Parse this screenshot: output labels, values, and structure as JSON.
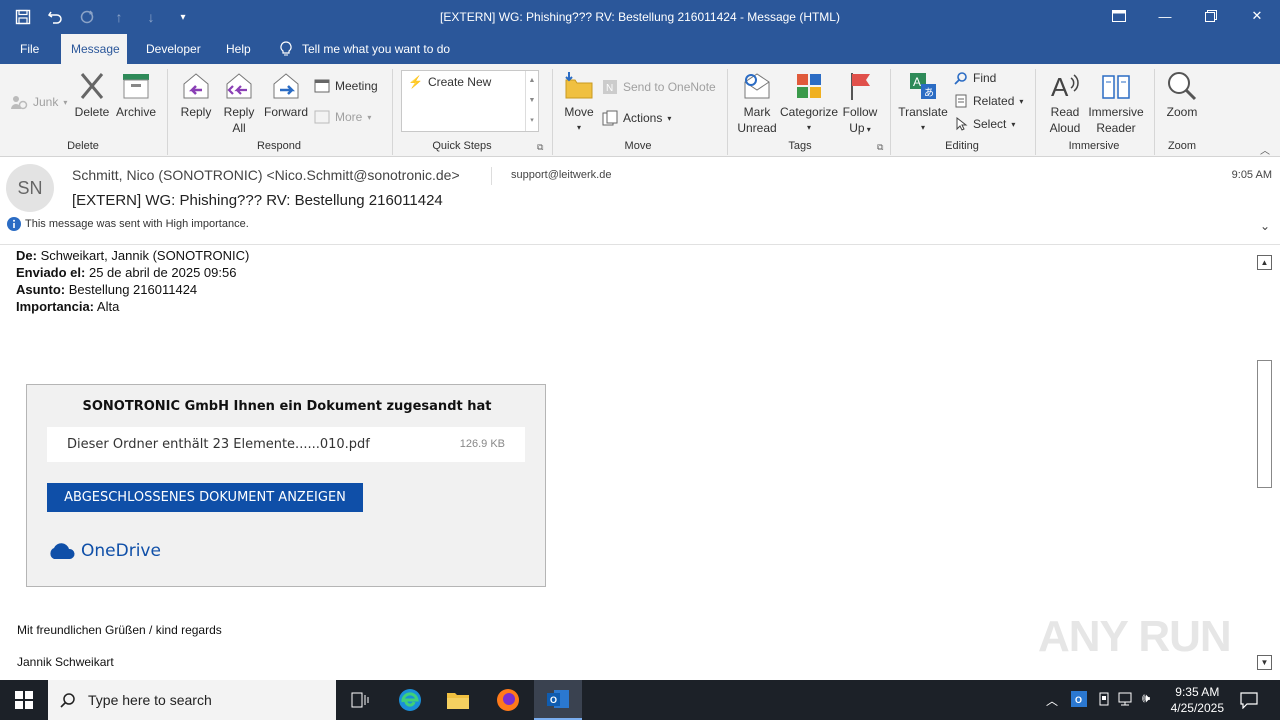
{
  "window": {
    "title": "[EXTERN] WG: Phishing???  RV: Bestellung 216011424  -  Message (HTML)"
  },
  "menu": {
    "tabs": [
      "File",
      "Message",
      "Developer",
      "Help"
    ],
    "tell_me": "Tell me what you want to do"
  },
  "ribbon": {
    "junk": "Junk",
    "delete": "Delete",
    "archive": "Archive",
    "delete_group": "Delete",
    "reply": "Reply",
    "reply_all_1": "Reply",
    "reply_all_2": "All",
    "forward": "Forward",
    "meeting": "Meeting",
    "more": "More",
    "respond_group": "Respond",
    "create_new": "Create New",
    "quick_steps_group": "Quick Steps",
    "move": "Move",
    "send_to_onenote": "Send to OneNote",
    "actions": "Actions",
    "move_group": "Move",
    "mark_unread_1": "Mark",
    "mark_unread_2": "Unread",
    "categorize": "Categorize",
    "follow_up_1": "Follow",
    "follow_up_2": "Up",
    "tags_group": "Tags",
    "translate": "Translate",
    "find": "Find",
    "related": "Related",
    "select": "Select",
    "editing_group": "Editing",
    "read_aloud_1": "Read",
    "read_aloud_2": "Aloud",
    "immersive_1": "Immersive",
    "immersive_2": "Reader",
    "immersive_group": "Immersive",
    "zoom": "Zoom",
    "zoom_group": "Zoom"
  },
  "header": {
    "avatar_initials": "SN",
    "from": "Schmitt, Nico (SONOTRONIC) <Nico.Schmitt@sonotronic.de>",
    "to": "support@leitwerk.de",
    "time": "9:05 AM",
    "subject": "[EXTERN] WG: Phishing???   RV: Bestellung 216011424",
    "importance": "This message was sent with High importance."
  },
  "body": {
    "meta": [
      {
        "label": "De:",
        "value": "Schweikart, Jannik (SONOTRONIC)"
      },
      {
        "label": "Enviado el:",
        "value": "25 de abril de 2025 09:56"
      },
      {
        "label": "Asunto:",
        "value": "Bestellung 216011424"
      },
      {
        "label": "Importancia:",
        "value": "Alta"
      }
    ],
    "card": {
      "title": "SONOTRONIC GmbH Ihnen ein Dokument zugesandt hat",
      "file_name": "Dieser Ordner enthält 23 Elemente......010.pdf",
      "file_size": "126.9 KB",
      "button": "ABGESCHLOSSENES DOKUMENT ANZEIGEN",
      "brand": "OneDrive"
    },
    "regards": "Mit freundlichen Grüßen  / kind regards",
    "signature": "Jannik Schweikart"
  },
  "watermark": "ANY RUN",
  "taskbar": {
    "search_placeholder": "Type here to search",
    "time": "9:35 AM",
    "date": "4/25/2025"
  }
}
